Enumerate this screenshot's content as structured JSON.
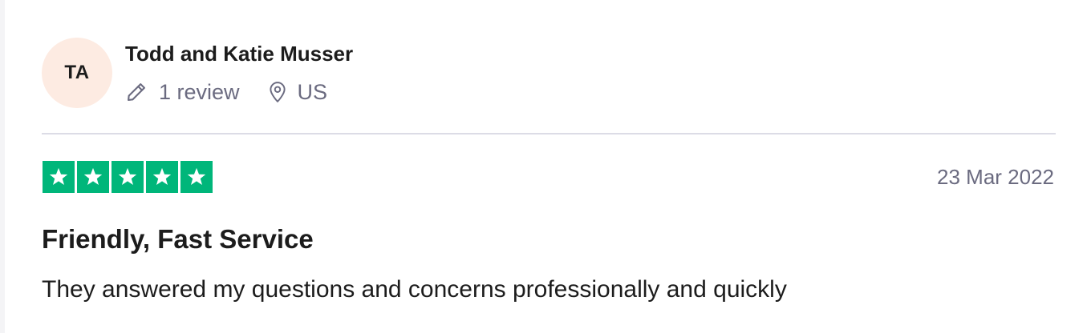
{
  "reviewer": {
    "initials": "TA",
    "name": "Todd and Katie Musser",
    "review_count": "1 review",
    "country": "US",
    "avatar_color": "#fdebe2"
  },
  "review": {
    "rating": 5,
    "rating_max": 5,
    "star_color": "#00b67a",
    "date": "23 Mar 2022",
    "title": "Friendly, Fast Service",
    "text": "They answered my questions and concerns professionally and quickly"
  },
  "icons": {
    "review_count": "pencil-icon",
    "country": "location-pin-icon",
    "rating": "star-icon"
  }
}
